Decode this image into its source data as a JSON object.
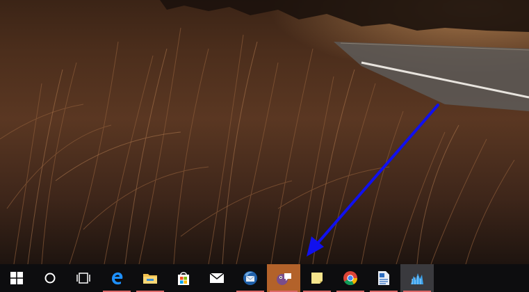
{
  "taskbar": {
    "items": [
      {
        "icon": "windows-start-icon",
        "running": false
      },
      {
        "icon": "cortana-search-icon",
        "running": false
      },
      {
        "icon": "task-view-icon",
        "running": false
      },
      {
        "icon": "edge-browser-icon",
        "running": true
      },
      {
        "icon": "file-explorer-icon",
        "running": true
      },
      {
        "icon": "store-icon",
        "running": false
      },
      {
        "icon": "mail-icon",
        "running": false
      },
      {
        "icon": "thunderbird-icon",
        "running": true
      },
      {
        "icon": "chat-app-icon",
        "running": true,
        "active": true
      },
      {
        "icon": "sticky-notes-icon",
        "running": true
      },
      {
        "icon": "chrome-icon",
        "running": true
      },
      {
        "icon": "document-editor-icon",
        "running": true
      },
      {
        "icon": "blue-app-icon",
        "running": true,
        "highlight": true
      }
    ]
  },
  "colors": {
    "taskbar_bg": "#0d0d0f",
    "running_indicator": "#e06a6a",
    "active_item": "#b3622a",
    "annotation_arrow": "#1010ee"
  }
}
